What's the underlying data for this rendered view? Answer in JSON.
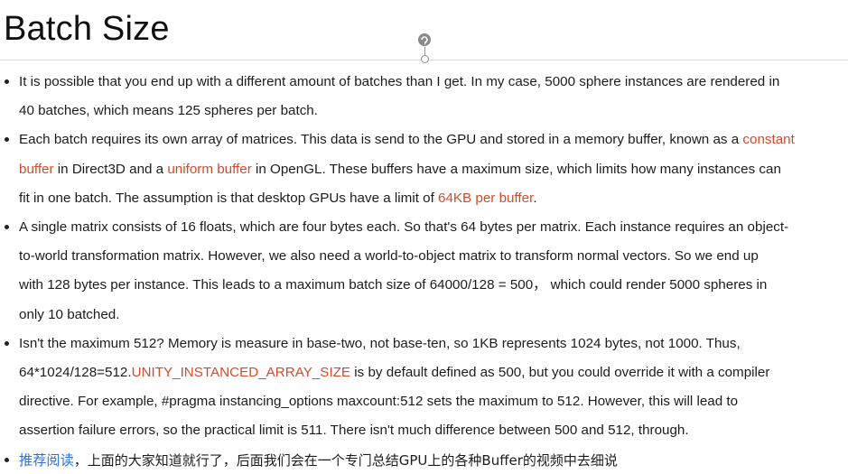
{
  "slide": {
    "title": "Batch Size",
    "bullets": [
      {
        "lines": [
          [
            {
              "text": "It is possible that you end up with a different amount of batches than I get. In my case, 5000 sphere instances are rendered in"
            }
          ],
          [
            {
              "text": "40 batches, which means 125 spheres per batch."
            }
          ]
        ]
      },
      {
        "lines": [
          [
            {
              "text": "Each batch requires its own array of matrices. This data is send to the GPU and stored in a memory buffer, known as a "
            },
            {
              "text": "constant",
              "style": "red"
            }
          ],
          [
            {
              "text": "buffer",
              "style": "red"
            },
            {
              "text": " in Direct3D and a "
            },
            {
              "text": "uniform buffer",
              "style": "red"
            },
            {
              "text": " in OpenGL. These buffers have a maximum size, which limits how many instances can"
            }
          ],
          [
            {
              "text": "fit in one batch. The assumption is that desktop GPUs have a limit of "
            },
            {
              "text": "64KB per buffer",
              "style": "red"
            },
            {
              "text": "."
            }
          ]
        ]
      },
      {
        "lines": [
          [
            {
              "text": "A single matrix consists of 16 floats, which are four bytes each. So that's 64 bytes per matrix. Each instance requires an object-"
            }
          ],
          [
            {
              "text": "to-world transformation matrix. However, we also need a world-to-object matrix to transform normal vectors. So we end up"
            }
          ],
          [
            {
              "text": "with 128 bytes per instance. This leads to a maximum batch size of 64000/128 = 500，  which could render 5000 spheres in"
            }
          ],
          [
            {
              "text": "only 10 batched."
            }
          ]
        ]
      },
      {
        "lines": [
          [
            {
              "text": "Isn't the maximum 512? Memory is measure in base-two, not base-ten, so 1KB represents 1024 bytes, not 1000. Thus,"
            }
          ],
          [
            {
              "text": "64*1024/128=512."
            },
            {
              "text": "UNITY_INSTANCED_ARRAY_SIZE",
              "style": "red"
            },
            {
              "text": " is by default defined as 500, but you could override it with a compiler"
            }
          ],
          [
            {
              "text": "directive. For example, #pragma instancing_options maxcount:512 sets the maximum to 512. However, this will lead to"
            }
          ],
          [
            {
              "text": "assertion failure errors, so the practical limit is 511. There isn't much difference between 500 and 512, through."
            }
          ]
        ]
      },
      {
        "lines": [
          [
            {
              "text": "推荐阅读",
              "style": "link"
            },
            {
              "text": "，上面的大家知道就行了，后面我们会在一个专门总结GPU上的各种Buffer的视频中去细说",
              "style": "cn"
            }
          ]
        ]
      }
    ]
  },
  "icons": {
    "rotate_handle": "rotate-handle-icon"
  },
  "colors": {
    "highlight_red": "#d24b2b",
    "link_blue": "#2f6fd6",
    "text": "#1c1c1c"
  }
}
